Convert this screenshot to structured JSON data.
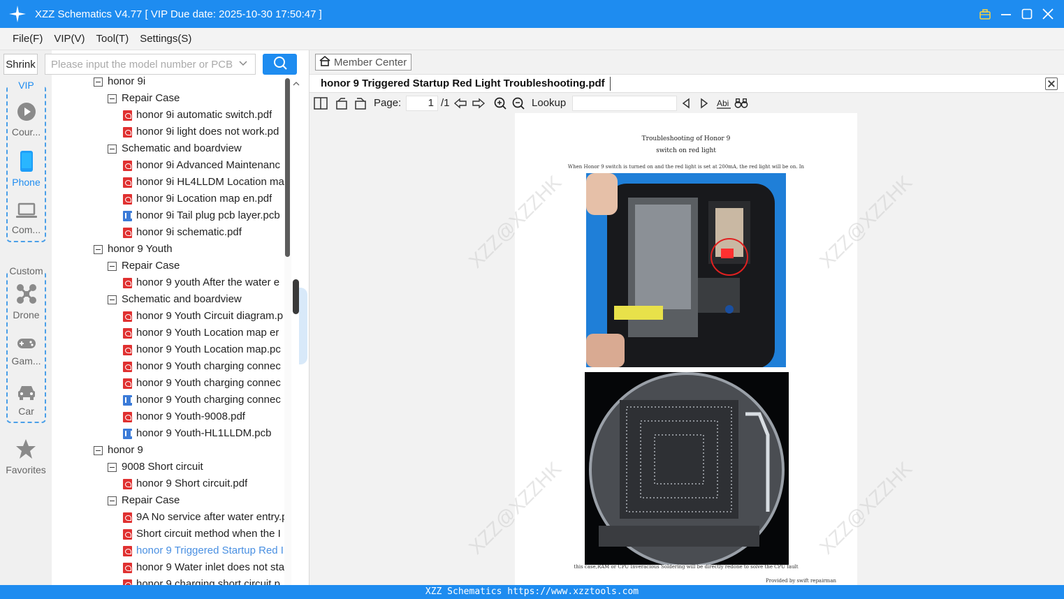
{
  "app": {
    "title": "XZZ Schematics V4.77 [ VIP Due date: 2025-10-30 17:50:47 ]"
  },
  "menu": [
    "File(F)",
    "VIP(V)",
    "Tool(T)",
    "Settings(S)"
  ],
  "leftbar": {
    "shrink_label": "Shrink",
    "vip_legend": "VIP",
    "custom_legend": "Custom",
    "vip_items": [
      "Cour...",
      "Phone",
      "Com..."
    ],
    "custom_items": [
      "Drone",
      "Gam...",
      "Car"
    ],
    "favorites_label": "Favorites"
  },
  "search": {
    "placeholder": "Please input the model number or PCB"
  },
  "tree": [
    {
      "level": 0,
      "type": "folder",
      "label": "honor 9i"
    },
    {
      "level": 1,
      "type": "folder",
      "label": "Repair Case"
    },
    {
      "level": 2,
      "type": "pdf",
      "label": "honor 9i automatic switch.pdf"
    },
    {
      "level": 2,
      "type": "pdf",
      "label": "honor 9i light does not work.pd"
    },
    {
      "level": 1,
      "type": "folder",
      "label": "Schematic and boardview"
    },
    {
      "level": 2,
      "type": "pdf",
      "label": "honor 9i Advanced Maintenanc"
    },
    {
      "level": 2,
      "type": "pdf",
      "label": "honor 9i HL4LLDM Location ma"
    },
    {
      "level": 2,
      "type": "pdf",
      "label": "honor 9i Location map en.pdf"
    },
    {
      "level": 2,
      "type": "pcb",
      "label": "honor 9i Tail plug pcb layer.pcb"
    },
    {
      "level": 2,
      "type": "pdf",
      "label": "honor 9i schematic.pdf"
    },
    {
      "level": 0,
      "type": "folder",
      "label": "honor 9 Youth"
    },
    {
      "level": 1,
      "type": "folder",
      "label": "Repair Case"
    },
    {
      "level": 2,
      "type": "pdf",
      "label": "honor 9 youth After the water e"
    },
    {
      "level": 1,
      "type": "folder",
      "label": "Schematic and boardview"
    },
    {
      "level": 2,
      "type": "pdf",
      "label": "honor 9 Youth Circuit diagram.p"
    },
    {
      "level": 2,
      "type": "pdf",
      "label": "honor 9 Youth Location map er"
    },
    {
      "level": 2,
      "type": "pdf",
      "label": "honor 9 Youth Location map.pc"
    },
    {
      "level": 2,
      "type": "pdf",
      "label": "honor 9 Youth charging connec"
    },
    {
      "level": 2,
      "type": "pdf",
      "label": "honor 9 Youth charging connec"
    },
    {
      "level": 2,
      "type": "pcb",
      "label": "honor 9 Youth charging connec"
    },
    {
      "level": 2,
      "type": "pdf",
      "label": "honor 9 Youth-9008.pdf"
    },
    {
      "level": 2,
      "type": "pcb",
      "label": "honor 9 Youth-HL1LLDM.pcb"
    },
    {
      "level": 0,
      "type": "folder",
      "label": "honor 9"
    },
    {
      "level": 1,
      "type": "folder",
      "label": "9008 Short circuit"
    },
    {
      "level": 2,
      "type": "pdf",
      "label": "honor 9 Short circuit.pdf"
    },
    {
      "level": 1,
      "type": "folder",
      "label": "Repair Case"
    },
    {
      "level": 2,
      "type": "pdf",
      "label": "9A No service after water entry.p"
    },
    {
      "level": 2,
      "type": "pdf",
      "label": "Short circuit method when the I"
    },
    {
      "level": 2,
      "type": "pdf",
      "label": "honor 9 Triggered Startup Red I",
      "selected": true
    },
    {
      "level": 2,
      "type": "pdf",
      "label": "honor 9 Water inlet does not sta"
    },
    {
      "level": 2,
      "type": "pdf",
      "label": "honor 9 charging short circuit.p"
    }
  ],
  "viewer": {
    "member_center": "Member Center",
    "tab_title": "honor 9 Triggered Startup Red Light Troubleshooting.pdf",
    "page_label": "Page:",
    "page_current": "1",
    "page_total": "/1",
    "lookup_label": "Lookup",
    "lookup_value": ""
  },
  "document": {
    "title_line1": "Troubleshooting of Honor 9",
    "title_line2": "switch on red light",
    "intro": "When Honor 9 switch is turned on and the red light is set at 200mA, the red light will be on. In",
    "footer": "this case,RAM or CPU Inveracious  Soldering will be directly redone to solve the CPU fault",
    "credit": "Provided by swift repairman",
    "watermark": "XZZ@XZZHK"
  },
  "statusbar": "XZZ Schematics https://www.xzztools.com",
  "colors": {
    "accent": "#1e8cf0",
    "pdf_icon": "#e03131",
    "pcb_icon": "#3b7bd8",
    "selected_text": "#4a90e2"
  }
}
